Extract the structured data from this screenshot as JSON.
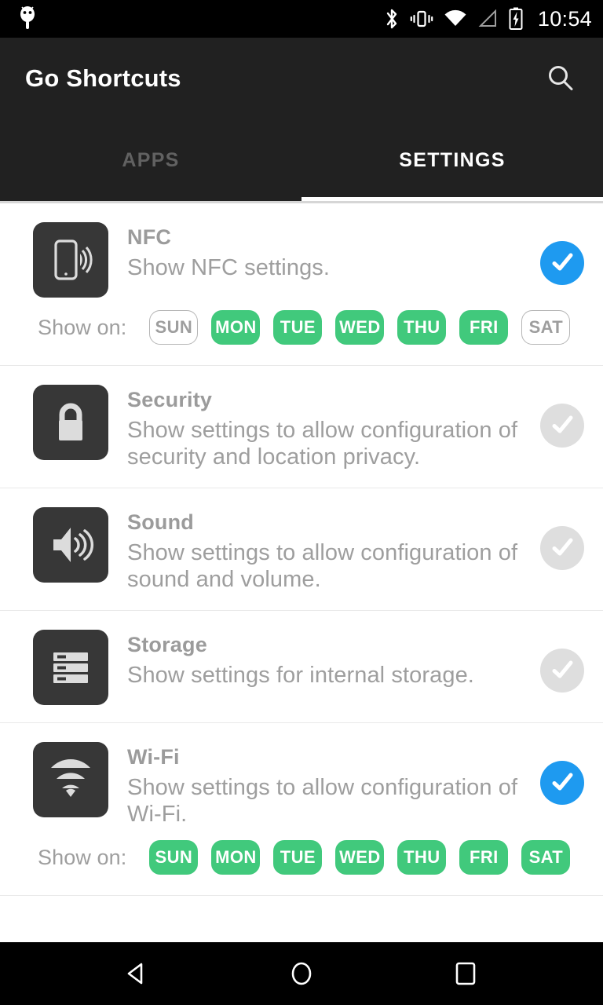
{
  "status_bar": {
    "time": "10:54",
    "icons": [
      "android-robot-icon",
      "bluetooth-icon",
      "vibrate-icon",
      "wifi-icon",
      "cell-signal-icon",
      "battery-charging-icon"
    ]
  },
  "app_bar": {
    "title": "Go Shortcuts",
    "search_icon": "search-icon",
    "tabs": [
      {
        "label": "APPS",
        "active": false
      },
      {
        "label": "SETTINGS",
        "active": true
      }
    ]
  },
  "colors": {
    "accent_checked": "#1e9af0",
    "unchecked": "#dedede",
    "day_on": "#41c97c",
    "app_bar_bg": "#212121",
    "icon_tile_bg": "#373737",
    "text_gray": "#9e9e9e"
  },
  "days_label": "Show on:",
  "rows": [
    {
      "icon": "nfc-icon",
      "title": "NFC",
      "description": "Show NFC settings.",
      "checked": true,
      "checkmark_glyph": "✔",
      "days": [
        {
          "label": "SUN",
          "on": false
        },
        {
          "label": "MON",
          "on": true
        },
        {
          "label": "TUE",
          "on": true
        },
        {
          "label": "WED",
          "on": true
        },
        {
          "label": "THU",
          "on": true
        },
        {
          "label": "FRI",
          "on": true
        },
        {
          "label": "SAT",
          "on": false
        }
      ]
    },
    {
      "icon": "lock-icon",
      "title": "Security",
      "description": "Show settings to allow configuration of security and location privacy.",
      "checked": false,
      "checkmark_glyph": "✔",
      "days": []
    },
    {
      "icon": "speaker-icon",
      "title": "Sound",
      "description": "Show settings to allow configuration of sound and volume.",
      "checked": false,
      "checkmark_glyph": "✔",
      "days": []
    },
    {
      "icon": "storage-icon",
      "title": "Storage",
      "description": "Show settings for internal storage.",
      "checked": false,
      "checkmark_glyph": "✔",
      "days": []
    },
    {
      "icon": "wifi-icon",
      "title": "Wi-Fi",
      "description": "Show settings to allow configuration of Wi-Fi.",
      "checked": true,
      "checkmark_glyph": "✔",
      "days": [
        {
          "label": "SUN",
          "on": true
        },
        {
          "label": "MON",
          "on": true
        },
        {
          "label": "TUE",
          "on": true
        },
        {
          "label": "WED",
          "on": true
        },
        {
          "label": "THU",
          "on": true
        },
        {
          "label": "FRI",
          "on": true
        },
        {
          "label": "SAT",
          "on": true
        }
      ]
    }
  ],
  "nav_bar": {
    "back": "back-triangle-icon",
    "home": "home-circle-icon",
    "recents": "recents-square-icon"
  }
}
